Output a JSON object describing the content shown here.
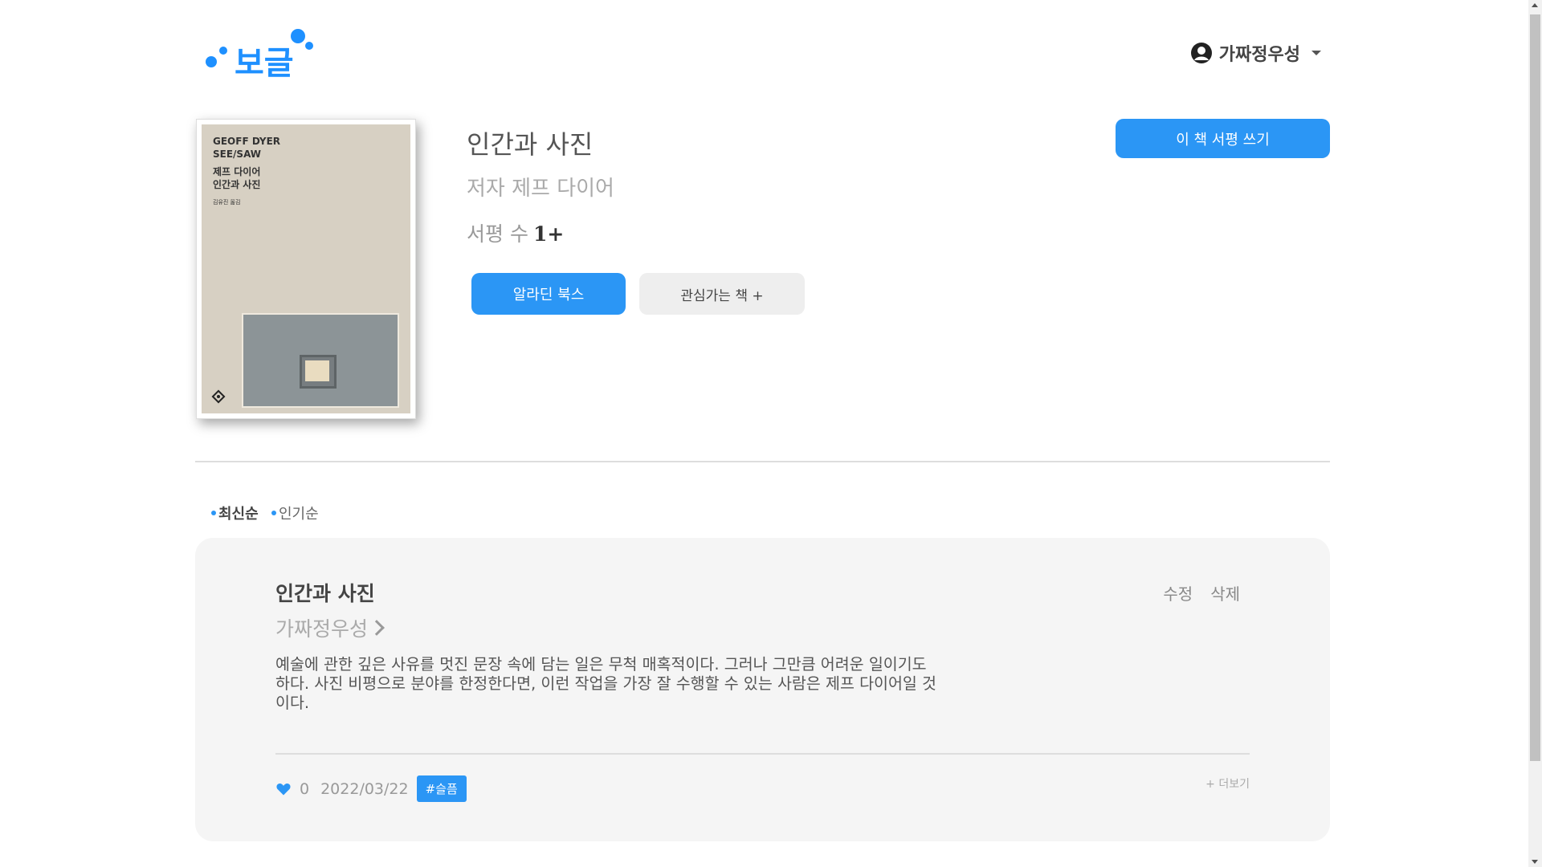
{
  "header": {
    "logo_text": "보글",
    "user_name": "가짜정우성"
  },
  "book": {
    "title": "인간과 사진",
    "author": "저자 제프 다이어",
    "review_count_label": "서평 수",
    "review_count_value": "1+",
    "cover": {
      "line1": "GEOFF DYER",
      "line2": "SEE/SAW",
      "line3": "제프 다이어",
      "line4": "인간과 사진",
      "translator": "김유진 옮김"
    },
    "write_review_label": "이 책 서평 쓰기",
    "aladin_label": "알라딘 북스",
    "interest_label": "관심가는 책 +"
  },
  "sort": {
    "options": [
      "최신순",
      "인기순"
    ],
    "selected": "최신순"
  },
  "review": {
    "title": "인간과 사진",
    "author": "가짜정우성",
    "edit_label": "수정",
    "delete_label": "삭제",
    "body": "예술에 관한 깊은 사유를 멋진 문장 속에 담는 일은 무척 매혹적이다. 그러나 그만큼 어려운 일이기도 하다. 사진 비평으로 분야를 한정한다면, 이런 작업을 가장 잘 수행할 수 있는 사람은 제프 다이어일 것이다.",
    "likes": "0",
    "date": "2022/03/22",
    "tag": "#슬픔",
    "more_label": "+ 더보기"
  },
  "colors": {
    "accent": "#2b96f5",
    "card_bg": "#f5f5f5",
    "cover_bg": "#d7d0c3"
  }
}
